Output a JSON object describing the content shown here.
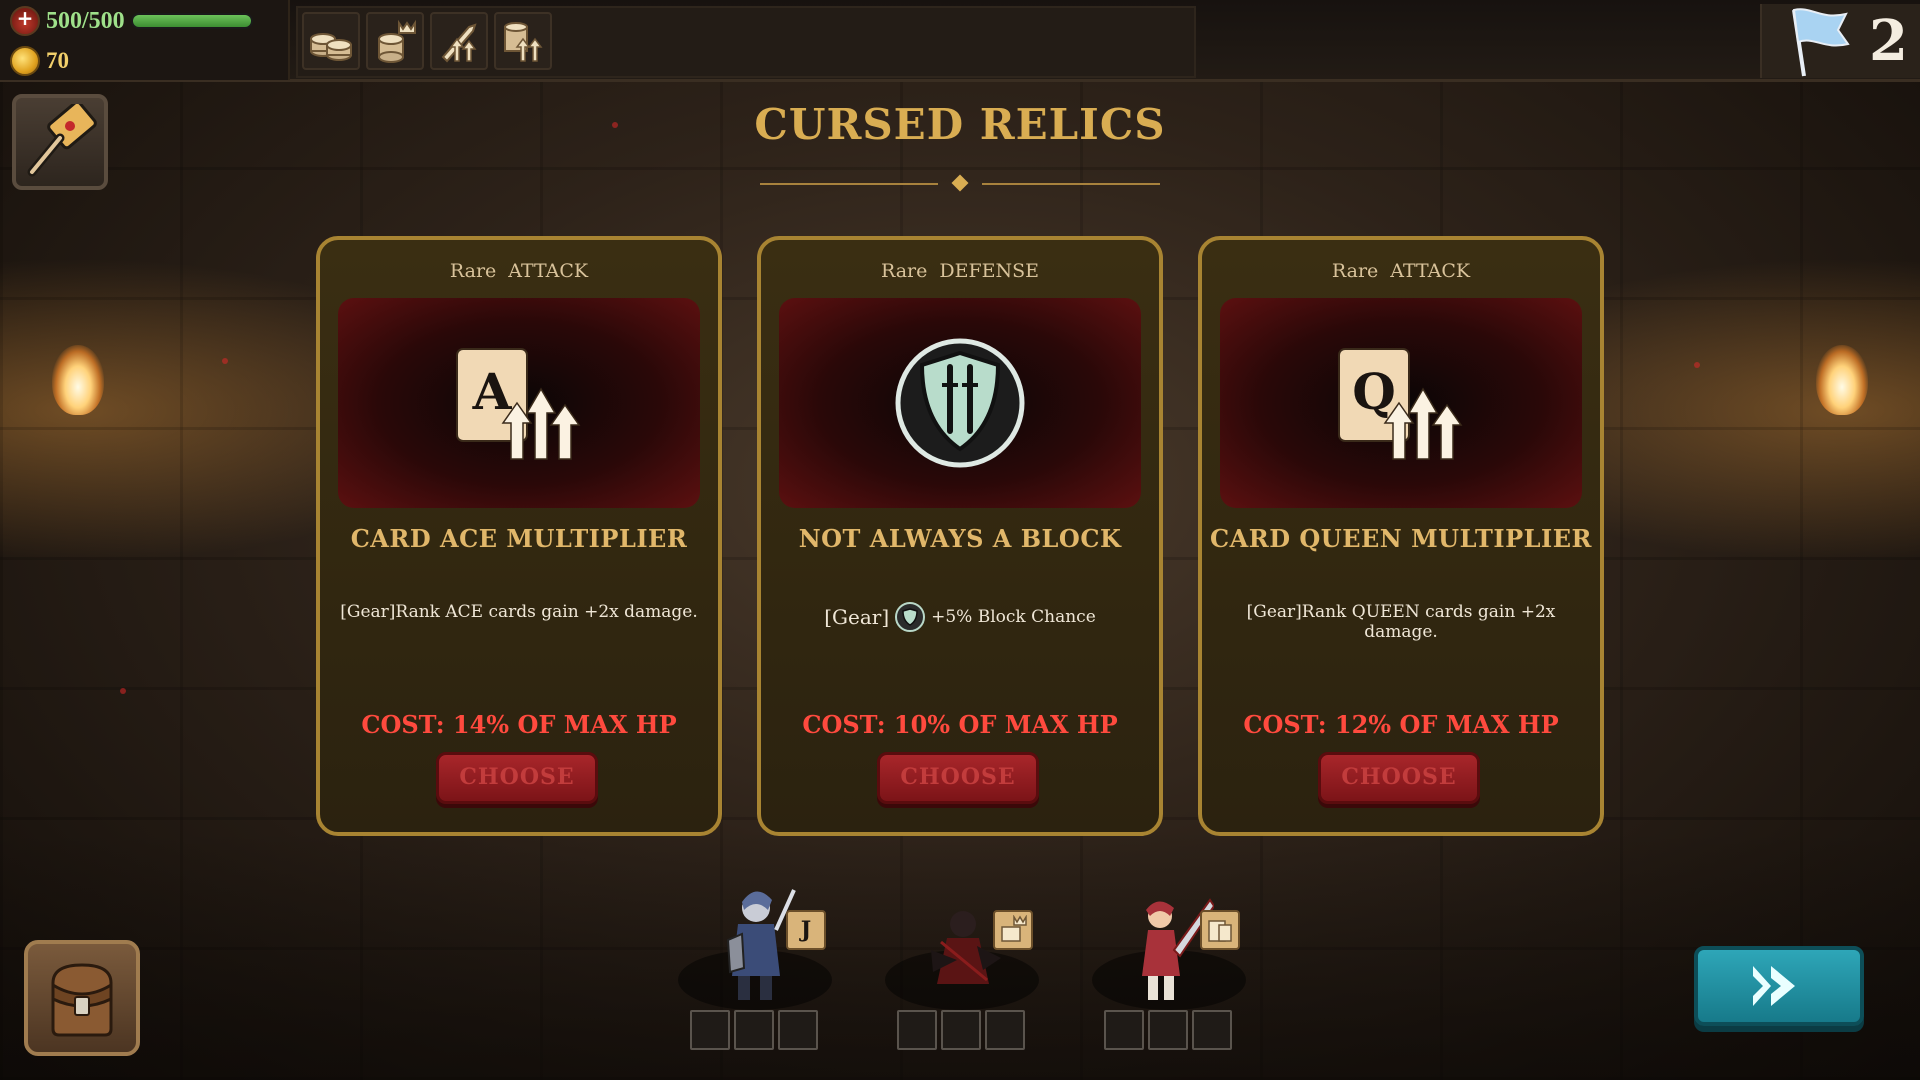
{
  "hud": {
    "hp_text": "500/500",
    "hp_fraction": 1.0,
    "gold": "70",
    "floor": "2",
    "relic_icons": [
      "coin-stack-icon",
      "crowned-coins-icon",
      "sword-upgrade-icon",
      "coins-arrows-icon"
    ]
  },
  "page": {
    "title": "CURSED RELICS"
  },
  "cards": [
    {
      "rarity": "Rare",
      "type": "ATTACK",
      "art": "ace-card-multiplier-icon",
      "art_letter": "A",
      "name": "CARD ACE MULTIPLIER",
      "description": "[Gear]Rank ACE cards gain +2x damage.",
      "cost": "COST: 14% OF MAX HP",
      "choose_label": "CHOOSE"
    },
    {
      "rarity": "Rare",
      "type": "DEFENSE",
      "art": "shield-swords-icon",
      "name": "NOT ALWAYS A BLOCK",
      "description_prefix": "[Gear]",
      "description_suffix": "+5% Block Chance",
      "cost": "COST: 10% OF MAX HP",
      "choose_label": "CHOOSE"
    },
    {
      "rarity": "Rare",
      "type": "ATTACK",
      "art": "queen-card-multiplier-icon",
      "art_letter": "Q",
      "name": "CARD QUEEN MULTIPLIER",
      "description": "[Gear]Rank QUEEN cards gain +2x damage.",
      "cost": "COST: 12% OF MAX HP",
      "choose_label": "CHOOSE"
    }
  ],
  "party": [
    {
      "hero": "knight-hero",
      "badge": "jack-card-badge-icon",
      "badge_letter": "J",
      "slots": 3
    },
    {
      "hero": "rogue-hero",
      "badge": "crowned-coins-badge-icon",
      "slots": 3
    },
    {
      "hero": "swordswoman-hero",
      "badge": "coins-badge-icon",
      "slots": 3
    }
  ],
  "colors": {
    "title": "#d9ad52",
    "card_border": "#a88432",
    "cost_red": "#ff4a3e",
    "choose_red": "#a8262a",
    "next_teal": "#2ea6b8",
    "hp_green": "#6cc25a",
    "gold": "#f2d06b"
  }
}
